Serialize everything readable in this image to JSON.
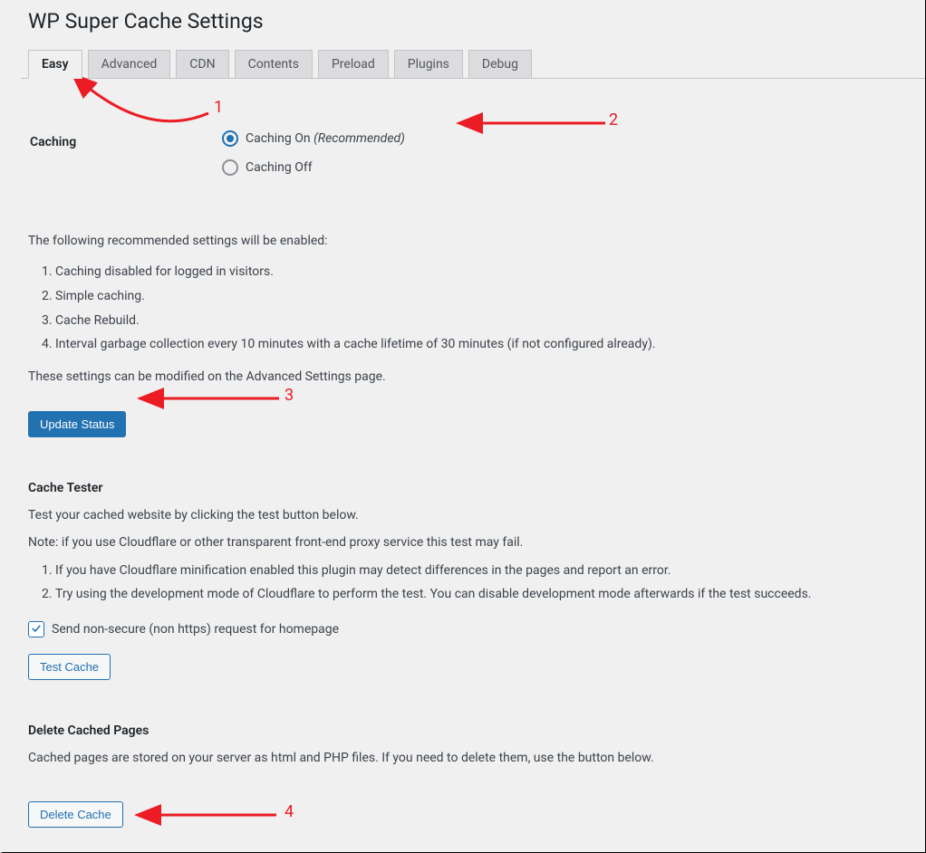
{
  "header": {
    "page_title": "WP Super Cache Settings"
  },
  "tabs": [
    "Easy",
    "Advanced",
    "CDN",
    "Contents",
    "Preload",
    "Plugins",
    "Debug"
  ],
  "caching": {
    "heading": "Caching",
    "option_on_label": "Caching On ",
    "option_on_hint": "(Recommended)",
    "option_off_label": "Caching Off"
  },
  "recommended": {
    "intro": "The following recommended settings will be enabled:",
    "items": [
      "Caching disabled for logged in visitors.",
      "Simple caching.",
      "Cache Rebuild.",
      "Interval garbage collection every 10 minutes with a cache lifetime of 30 minutes (if not configured already)."
    ],
    "footer": "These settings can be modified on the Advanced Settings page."
  },
  "buttons": {
    "update_status": "Update Status",
    "test_cache": "Test Cache",
    "delete_cache": "Delete Cache"
  },
  "cache_tester": {
    "heading": "Cache Tester",
    "intro": "Test your cached website by clicking the test button below.",
    "note": "Note: if you use Cloudflare or other transparent front-end proxy service this test may fail.",
    "items": [
      "If you have Cloudflare minification enabled this plugin may detect differences in the pages and report an error.",
      "Try using the development mode of Cloudflare to perform the test. You can disable development mode afterwards if the test succeeds."
    ],
    "checkbox_label": "Send non-secure (non https) request for homepage"
  },
  "delete_section": {
    "heading": "Delete Cached Pages",
    "intro": "Cached pages are stored on your server as html and PHP files. If you need to delete them, use the button below."
  },
  "annotations": {
    "a1": "1",
    "a2": "2",
    "a3": "3",
    "a4": "4"
  }
}
